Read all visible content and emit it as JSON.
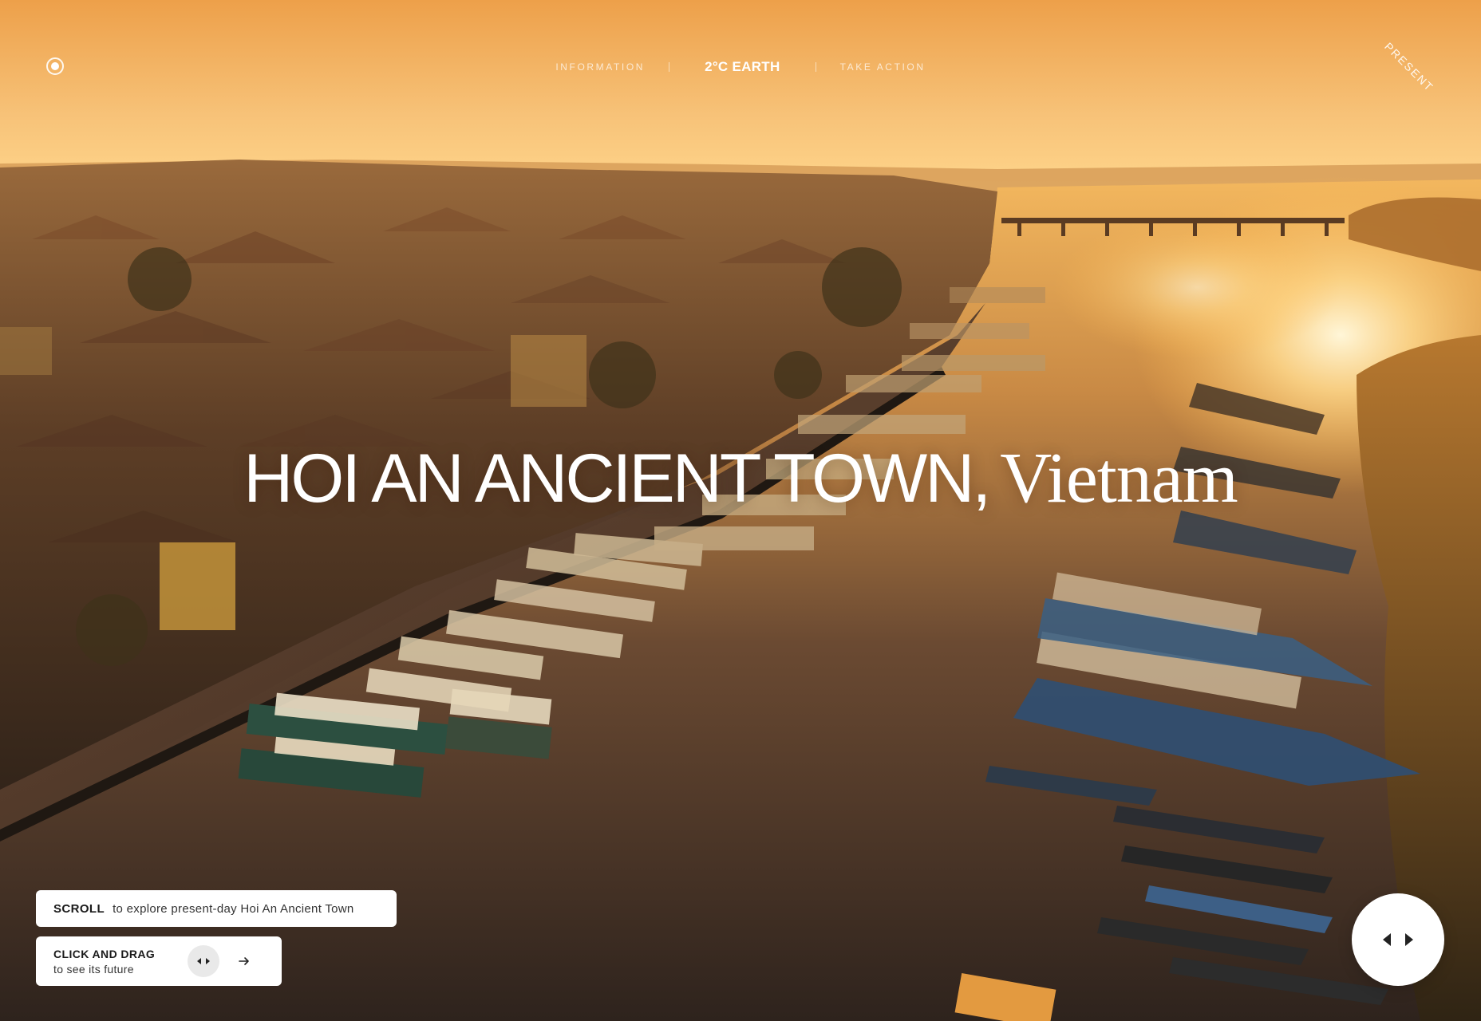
{
  "nav": {
    "information": "INFORMATION",
    "logo": "2°C EARTH",
    "take_action": "TAKE ACTION",
    "present_tag": "PRESENT"
  },
  "headline": {
    "place": "HOI AN ANCIENT TOWN,",
    "country": "Vietnam"
  },
  "hints": {
    "scroll_key": "SCROLL",
    "scroll_text": "to explore present-day Hoi An Ancient Town",
    "drag_key": "CLICK AND DRAG",
    "drag_text": "to see its future"
  },
  "icons": {
    "menu": "circle-dot-icon",
    "drag_hint": "left-right-arrows-icon",
    "next": "arrow-right-icon",
    "slider": "left-right-arrows-icon"
  },
  "colors": {
    "sky_top": "#f0a445",
    "sky_horizon": "#ffd98a",
    "river": "#3e2d22",
    "town": "#4a3423",
    "sun": "#fff2c4"
  }
}
